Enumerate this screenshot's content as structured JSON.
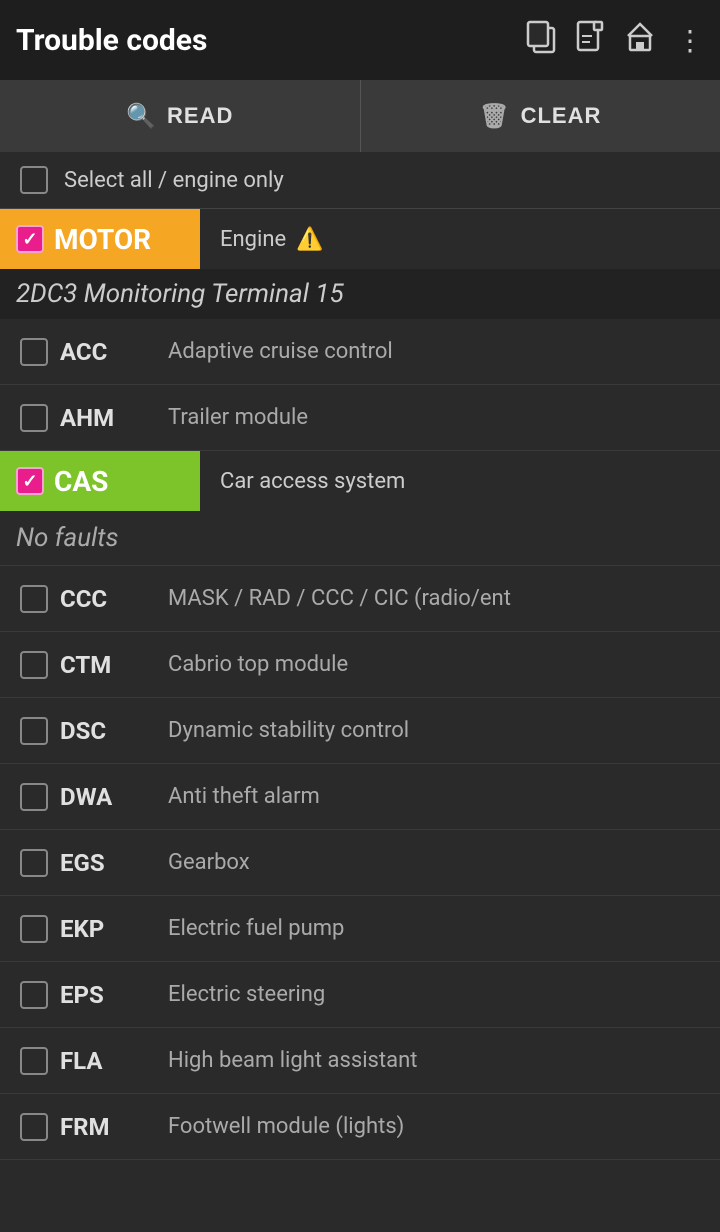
{
  "header": {
    "title": "Trouble codes",
    "icons": [
      "copy",
      "document",
      "home",
      "more"
    ]
  },
  "toolbar": {
    "read_label": "READ",
    "clear_label": "CLEAR"
  },
  "select_all": {
    "label": "Select all / engine only",
    "checked": false
  },
  "modules": [
    {
      "code": "MOTOR",
      "color": "orange",
      "checked": true,
      "description": "Engine",
      "warning": true,
      "section_label": "2DC3 Monitoring Terminal 15",
      "status": null,
      "items": [
        {
          "code": "ACC",
          "description": "Adaptive cruise control",
          "checked": false
        },
        {
          "code": "AHM",
          "description": "Trailer module",
          "checked": false
        }
      ]
    },
    {
      "code": "CAS",
      "color": "green",
      "checked": true,
      "description": "Car access system",
      "warning": false,
      "section_label": null,
      "status": "No faults",
      "items": [
        {
          "code": "CCC",
          "description": "MASK / RAD / CCC / CIC (radio/ent",
          "checked": false
        },
        {
          "code": "CTM",
          "description": "Cabrio top module",
          "checked": false
        },
        {
          "code": "DSC",
          "description": "Dynamic stability control",
          "checked": false
        },
        {
          "code": "DWA",
          "description": "Anti theft alarm",
          "checked": false
        },
        {
          "code": "EGS",
          "description": "Gearbox",
          "checked": false
        },
        {
          "code": "EKP",
          "description": "Electric fuel pump",
          "checked": false
        },
        {
          "code": "EPS",
          "description": "Electric steering",
          "checked": false
        },
        {
          "code": "FLA",
          "description": "High beam light assistant",
          "checked": false
        },
        {
          "code": "FRM",
          "description": "Footwell module (lights)",
          "checked": false
        }
      ]
    }
  ]
}
